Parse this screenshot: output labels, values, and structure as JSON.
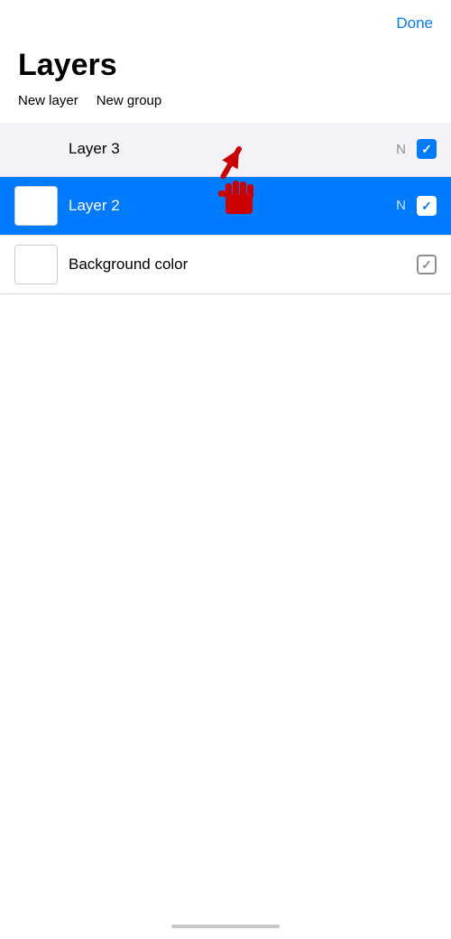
{
  "header": {
    "done_label": "Done"
  },
  "title_section": {
    "title": "Layers"
  },
  "actions": {
    "new_layer_label": "New layer",
    "new_group_label": "New group"
  },
  "layers": [
    {
      "id": "layer3",
      "name": "Layer 3",
      "blend": "N",
      "visible": true,
      "active": false,
      "has_thumbnail": false
    },
    {
      "id": "layer2",
      "name": "Layer 2",
      "blend": "N",
      "visible": true,
      "active": true,
      "has_thumbnail": true
    },
    {
      "id": "background-color",
      "name": "Background color",
      "blend": "",
      "visible": true,
      "active": false,
      "has_thumbnail": true
    }
  ],
  "colors": {
    "accent": "#007AFF",
    "active_row_bg": "#007AFF",
    "inactive_row_bg": "#f2f2f7",
    "bg_row_bg": "#ffffff"
  }
}
